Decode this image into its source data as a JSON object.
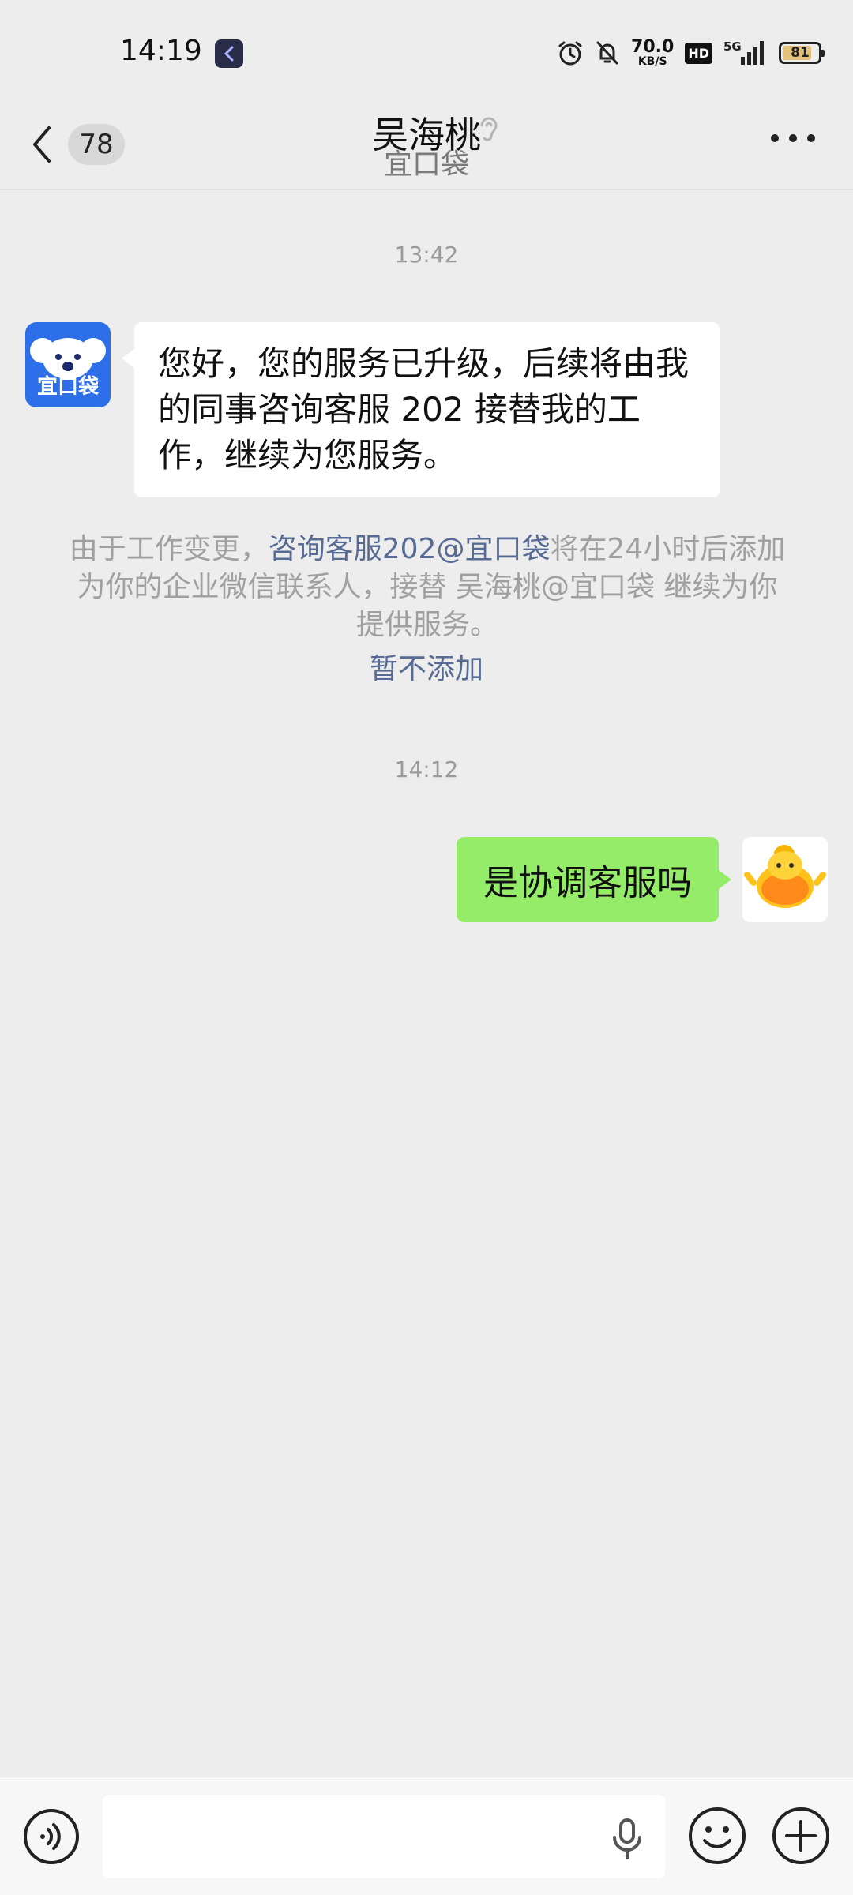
{
  "status_bar": {
    "time": "14:19",
    "net_speed_value": "70.0",
    "net_speed_unit": "KB/S",
    "hd_label": "HD",
    "network": "5G",
    "battery": "81",
    "battery_level_percent": 81,
    "icons": [
      "alarm-icon",
      "mute-bell-icon",
      "signal-icon",
      "battery-icon"
    ]
  },
  "header": {
    "unread_count": "78",
    "title": "吴海桃",
    "subtitle": "宜口袋",
    "icons": [
      "back-icon",
      "ear-icon",
      "more-icon"
    ]
  },
  "messages": {
    "ts1": "13:42",
    "incoming_text": "您好，您的服务已升级，后续将由我的同事咨询客服 202 接替我的工作，继续为您服务。",
    "incoming_avatar_brand": "宜口袋",
    "notice_pre": "由于工作变更，",
    "notice_link": "咨询客服202@宜口袋",
    "notice_post": "将在24小时后添加为你的企业微信联系人，接替 吴海桃@宜口袋 继续为你提供服务。",
    "notice_action": "暂不添加",
    "ts2": "14:12",
    "outgoing_text": "是协调客服吗"
  },
  "input_bar": {
    "icons": [
      "voice-icon",
      "mic-icon",
      "emoji-icon",
      "plus-icon"
    ]
  },
  "colors": {
    "background": "#ededed",
    "outgoing_bubble": "#95ec69",
    "incoming_bubble": "#ffffff",
    "link": "#576b95",
    "avatar_brand": "#2d6fe8"
  }
}
